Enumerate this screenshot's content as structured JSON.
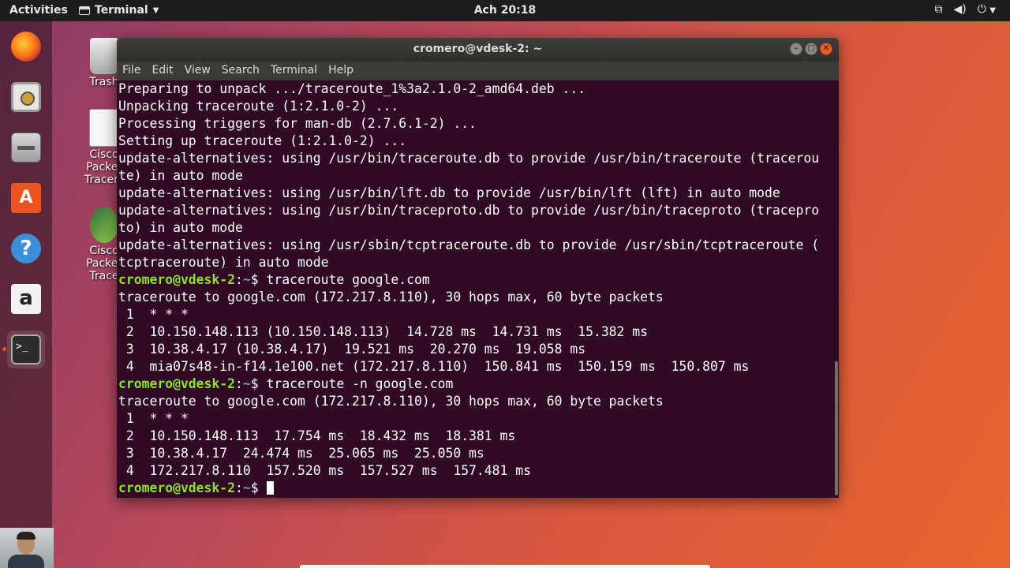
{
  "topbar": {
    "activities": "Activities",
    "app_menu": "Terminal",
    "clock": "Ach 20:18",
    "tray": [
      "network-icon",
      "volume-icon",
      "power-icon"
    ]
  },
  "dock": {
    "items": [
      "firefox-icon",
      "rhythmbox-icon",
      "files-icon",
      "software-center-icon",
      "help-icon",
      "amazon-icon",
      "terminal-icon"
    ],
    "active": "terminal-icon"
  },
  "desktop": {
    "icons": [
      {
        "name": "trash",
        "label": "Trash"
      },
      {
        "name": "cisco-packet-tracer-file",
        "label": "Cisco Packet Tracer.l"
      },
      {
        "name": "cisco-packet-tracer",
        "label": "Cisco Packet Trace"
      }
    ]
  },
  "window": {
    "title": "cromero@vdesk-2: ~",
    "menu": [
      "File",
      "Edit",
      "View",
      "Search",
      "Terminal",
      "Help"
    ]
  },
  "terminal": {
    "prompt_user": "cromero@vdesk-2",
    "prompt_path": "~",
    "lines": [
      {
        "type": "out",
        "text": "Preparing to unpack .../traceroute_1%3a2.1.0-2_amd64.deb ..."
      },
      {
        "type": "out",
        "text": "Unpacking traceroute (1:2.1.0-2) ..."
      },
      {
        "type": "out",
        "text": "Processing triggers for man-db (2.7.6.1-2) ..."
      },
      {
        "type": "out",
        "text": "Setting up traceroute (1:2.1.0-2) ..."
      },
      {
        "type": "out",
        "text": "update-alternatives: using /usr/bin/traceroute.db to provide /usr/bin/traceroute (tracerou"
      },
      {
        "type": "out",
        "text": "te) in auto mode"
      },
      {
        "type": "out",
        "text": "update-alternatives: using /usr/bin/lft.db to provide /usr/bin/lft (lft) in auto mode"
      },
      {
        "type": "out",
        "text": "update-alternatives: using /usr/bin/traceproto.db to provide /usr/bin/traceproto (tracepro"
      },
      {
        "type": "out",
        "text": "to) in auto mode"
      },
      {
        "type": "out",
        "text": "update-alternatives: using /usr/sbin/tcptraceroute.db to provide /usr/sbin/tcptraceroute ("
      },
      {
        "type": "out",
        "text": "tcptraceroute) in auto mode"
      },
      {
        "type": "cmd",
        "text": " traceroute google.com"
      },
      {
        "type": "out",
        "text": "traceroute to google.com (172.217.8.110), 30 hops max, 60 byte packets"
      },
      {
        "type": "out",
        "text": " 1  * * *"
      },
      {
        "type": "out",
        "text": " 2  10.150.148.113 (10.150.148.113)  14.728 ms  14.731 ms  15.382 ms"
      },
      {
        "type": "out",
        "text": " 3  10.38.4.17 (10.38.4.17)  19.521 ms  20.270 ms  19.058 ms"
      },
      {
        "type": "out",
        "text": " 4  mia07s48-in-f14.1e100.net (172.217.8.110)  150.841 ms  150.159 ms  150.807 ms"
      },
      {
        "type": "cmd",
        "text": " traceroute -n google.com"
      },
      {
        "type": "out",
        "text": "traceroute to google.com (172.217.8.110), 30 hops max, 60 byte packets"
      },
      {
        "type": "out",
        "text": " 1  * * *"
      },
      {
        "type": "out",
        "text": " 2  10.150.148.113  17.754 ms  18.432 ms  18.381 ms"
      },
      {
        "type": "out",
        "text": " 3  10.38.4.17  24.474 ms  25.065 ms  25.050 ms"
      },
      {
        "type": "out",
        "text": " 4  172.217.8.110  157.520 ms  157.527 ms  157.481 ms"
      },
      {
        "type": "prompt",
        "text": " "
      }
    ]
  },
  "colors": {
    "terminal_bg": "#300a24",
    "prompt_user": "#8ae234",
    "prompt_path": "#729fcf",
    "accent": "#e95420"
  }
}
